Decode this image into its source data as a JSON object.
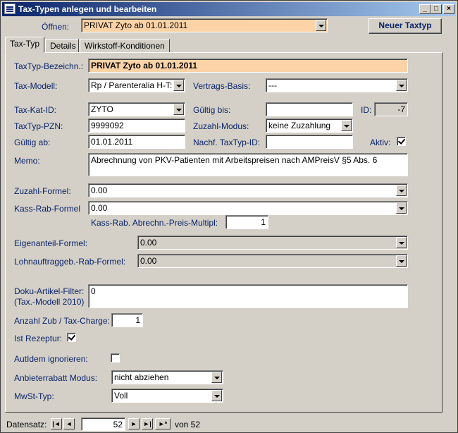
{
  "window": {
    "title": "Tax-Typen anlegen und bearbeiten",
    "buttons": {
      "minimize": "_",
      "maximize": "□",
      "close": "×"
    }
  },
  "header": {
    "open_label": "Öffnen:",
    "open_value": "PRIVAT Zyto ab 01.01.2011",
    "new_button": "Neuer Taxtyp"
  },
  "tabs": [
    {
      "label": "Tax-Typ",
      "active": true
    },
    {
      "label": "Details",
      "active": false
    },
    {
      "label": "Wirkstoff-Konditionen",
      "active": false
    }
  ],
  "form": {
    "bezeichnung": {
      "label": "TaxTyp-Bezeichn.:",
      "value": "PRIVAT Zyto ab 01.01.2011"
    },
    "modell": {
      "label": "Tax-Modell:",
      "value": "Rp / Parenteralia H-T:"
    },
    "vertragsbasis": {
      "label": "Vertrags-Basis:",
      "value": "---"
    },
    "katid": {
      "label": "Tax-Kat-ID:",
      "value": "ZYTO"
    },
    "gueltigbis": {
      "label": "Gültig bis:",
      "value": ""
    },
    "id": {
      "label": "ID:",
      "value": "-7"
    },
    "pzn": {
      "label": "TaxTyp-PZN:",
      "value": "9999092"
    },
    "zuzahlmodus": {
      "label": "Zuzahl-Modus:",
      "value": "keine Zuzahlung"
    },
    "gueltigab": {
      "label": "Gültig ab:",
      "value": "01.01.2011"
    },
    "nachf": {
      "label": "Nachf. TaxTyp-ID:",
      "value": ""
    },
    "aktiv": {
      "label": "Aktiv:",
      "checked": true
    },
    "memo": {
      "label": "Memo:",
      "value": "Abrechnung von PKV-Patienten mit Arbeitspreisen nach AMPreisV  §5 Abs. 6"
    },
    "zuzahlformel": {
      "label": "Zuzahl-Formel:",
      "value": "0.00"
    },
    "kassrabformel": {
      "label": "Kass-Rab-Formel",
      "value": "0.00"
    },
    "kassrabmultipl": {
      "label": "Kass-Rab. Abrechn.-Preis-Multipl:",
      "value": "1"
    },
    "eigenanteil": {
      "label": "Eigenanteil-Formel:",
      "value": "0.00"
    },
    "lohnauftrag": {
      "label": "Lohnauftraggeb.-Rab-Formel:",
      "value": "0.00"
    },
    "dokufilter": {
      "label1": "Doku-Artikel-Filter:",
      "label2": "(Tax.-Modell 2010)",
      "value": "0"
    },
    "anzahlzub": {
      "label": "Anzahl Zub / Tax-Charge:",
      "value": "1"
    },
    "istrezeptur": {
      "label": "Ist Rezeptur:",
      "checked": true
    },
    "autidem": {
      "label": "AutIdem ignorieren:",
      "checked": false
    },
    "anbieterrabatt": {
      "label": "Anbieterrabatt Modus:",
      "value": "nicht abziehen"
    },
    "mwst": {
      "label": "MwSt-Typ:",
      "value": "Voll"
    }
  },
  "recordnav": {
    "label": "Datensatz:",
    "current": "52",
    "of_label": "von 52",
    "first": "|◄",
    "prev": "◄",
    "next": "►",
    "last": "►|",
    "new": "►*"
  }
}
